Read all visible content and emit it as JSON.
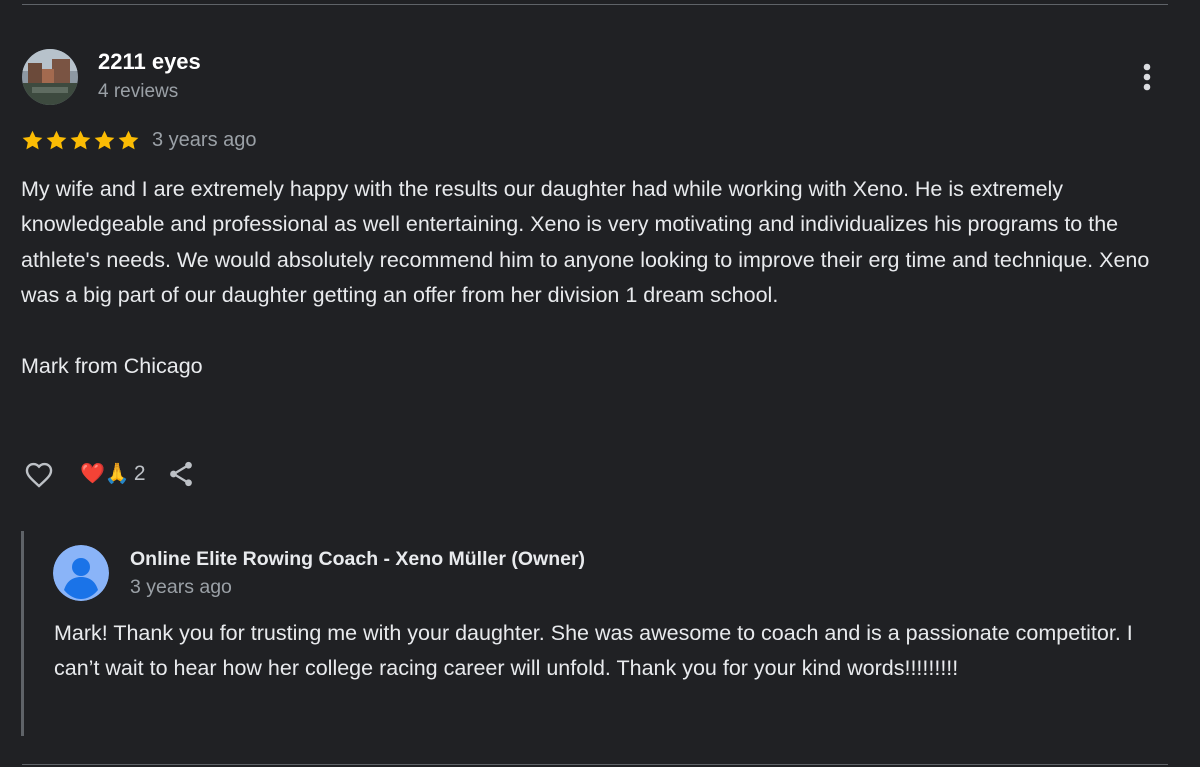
{
  "review": {
    "reviewer_name": "2211 eyes",
    "reviewer_meta": "4 reviews",
    "rating": 5,
    "date": "3 years ago",
    "text": "My wife and I are extremely happy with the results our daughter had while working with Xeno. He is extremely knowledgeable and professional as well entertaining. Xeno is very motivating and individualizes his programs to the athlete's needs. We would absolutely recommend him to anyone looking to improve their erg time and technique. Xeno was a big part of our daughter getting an offer from her division 1 dream school.\n\nMark from Chicago",
    "reactions": {
      "emojis": "❤️🙏",
      "count": "2"
    }
  },
  "reply": {
    "owner_name": "Online Elite Rowing Coach - Xeno Müller (Owner)",
    "date": "3 years ago",
    "text": "Mark! Thank you for trusting me with your daughter. She was awesome to coach and is a passionate competitor. I can’t wait to hear how her college racing career will unfold. Thank you for your kind words!!!!!!!!!"
  },
  "icons": {
    "more": "more-vert-icon",
    "like": "heart-outline-icon",
    "share": "share-icon",
    "star": "star-icon"
  },
  "colors": {
    "background": "#202124",
    "star": "#fbbc04",
    "owner_avatar": "#8ab4f8"
  }
}
